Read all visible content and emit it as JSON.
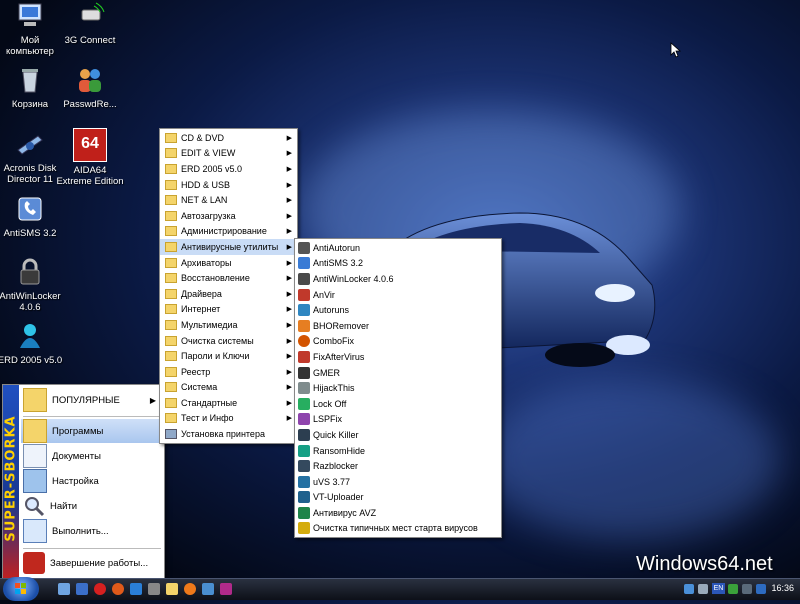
{
  "desktop": {
    "icons": [
      {
        "label": "Мой\nкомпьютер",
        "icon": "computer-icon"
      },
      {
        "label": "3G Connect",
        "icon": "modem-icon"
      },
      {
        "label": "Корзина",
        "icon": "recycle-bin-icon"
      },
      {
        "label": "PasswdRe...",
        "icon": "users-icon"
      },
      {
        "label": "Acronis Disk\nDirector 11",
        "icon": "acronis-icon"
      },
      {
        "label": "AIDA64\nExtreme Edition",
        "icon": "aida64-icon"
      },
      {
        "label": "AntiSMS 3.2",
        "icon": "antisms-icon"
      },
      {
        "label": "AntiWinLocker\n4.0.6",
        "icon": "lock-icon"
      },
      {
        "label": "ERD 2005 v5.0",
        "icon": "erd-icon"
      }
    ],
    "aida_badge": "64"
  },
  "start_menu": {
    "banner": "SUPER-SBORKA",
    "items": [
      {
        "label": "ПОПУЛЯРНЫЕ",
        "icon": "folder-icon",
        "submenu": true
      },
      {
        "label": "Программы",
        "icon": "folder-icon",
        "submenu": false
      },
      {
        "label": "Документы",
        "icon": "documents-icon",
        "submenu": false
      },
      {
        "label": "Настройка",
        "icon": "control-panel-icon",
        "submenu": false
      },
      {
        "label": "Найти",
        "icon": "search-icon",
        "submenu": false
      },
      {
        "label": "Выполнить...",
        "icon": "run-icon",
        "submenu": false
      },
      {
        "label": "Завершение работы...",
        "icon": "shutdown-icon",
        "submenu": false
      }
    ]
  },
  "programs_menu": {
    "items": [
      {
        "label": "CD & DVD",
        "submenu": true
      },
      {
        "label": "EDIT & VIEW",
        "submenu": true
      },
      {
        "label": "ERD 2005 v5.0",
        "submenu": true
      },
      {
        "label": "HDD & USB",
        "submenu": true
      },
      {
        "label": "NET & LAN",
        "submenu": true
      },
      {
        "label": "Автозагрузка",
        "submenu": true
      },
      {
        "label": "Администрирование",
        "submenu": true
      },
      {
        "label": "Антивирусные утилиты",
        "submenu": true
      },
      {
        "label": "Архиваторы",
        "submenu": true
      },
      {
        "label": "Восстановление",
        "submenu": true
      },
      {
        "label": "Драйвера",
        "submenu": true
      },
      {
        "label": "Интернет",
        "submenu": true
      },
      {
        "label": "Мультимедиа",
        "submenu": true
      },
      {
        "label": "Очистка системы",
        "submenu": true
      },
      {
        "label": "Пароли и Ключи",
        "submenu": true
      },
      {
        "label": "Реестр",
        "submenu": true
      },
      {
        "label": "Система",
        "submenu": true
      },
      {
        "label": "Стандартные",
        "submenu": true
      },
      {
        "label": "Тест и Инфо",
        "submenu": true
      },
      {
        "label": "Установка принтера",
        "submenu": false
      }
    ],
    "highlighted_index": 7
  },
  "antivirus_menu": {
    "items": [
      {
        "label": "AntiAutorun",
        "color": "#555555"
      },
      {
        "label": "AntiSMS 3.2",
        "color": "#3a7bd5"
      },
      {
        "label": "AntiWinLocker 4.0.6",
        "color": "#4a4a4a"
      },
      {
        "label": "AnVir",
        "color": "#c0392b"
      },
      {
        "label": "Autoruns",
        "color": "#2e86c1"
      },
      {
        "label": "BHORemover",
        "color": "#e67e22"
      },
      {
        "label": "ComboFix",
        "color": "#d35400"
      },
      {
        "label": "FixAfterVirus",
        "color": "#c0392b"
      },
      {
        "label": "GMER",
        "color": "#333333"
      },
      {
        "label": "HijackThis",
        "color": "#7f8c8d"
      },
      {
        "label": "Lock Off",
        "color": "#27ae60"
      },
      {
        "label": "LSPFix",
        "color": "#8e44ad"
      },
      {
        "label": "Quick Killer",
        "color": "#2c3e50"
      },
      {
        "label": "RansomHide",
        "color": "#16a085"
      },
      {
        "label": "Razblocker",
        "color": "#34495e"
      },
      {
        "label": "uVS 3.77",
        "color": "#2471a3"
      },
      {
        "label": "VT-Uploader",
        "color": "#1f618d"
      },
      {
        "label": "Антивирус AVZ",
        "color": "#1e8449"
      },
      {
        "label": "Очистка типичных мест старта вирусов",
        "color": "#d4ac0d"
      }
    ]
  },
  "taskbar": {
    "language": "EN",
    "clock": "16:36"
  },
  "watermark": "Windows64.net"
}
